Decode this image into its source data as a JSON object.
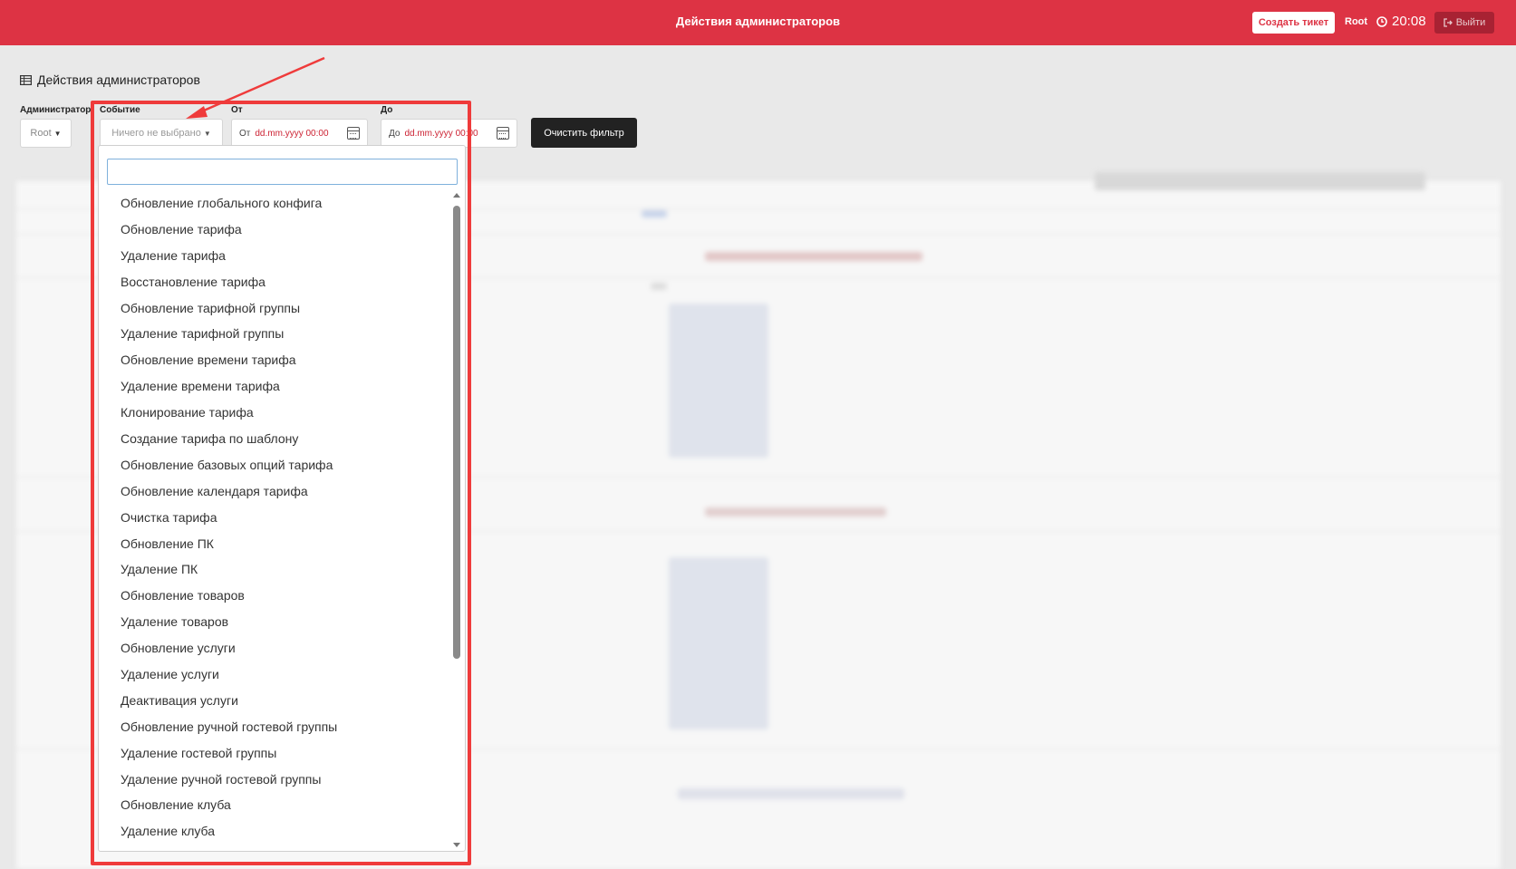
{
  "header": {
    "title": "Действия администраторов",
    "create_ticket": "Создать тикет",
    "user": "Root",
    "time": "20:08",
    "logout": "Выйти"
  },
  "page": {
    "title": "Действия администраторов"
  },
  "filters": {
    "admin_label": "Администратор",
    "admin_value": "Root",
    "event_label": "Событие",
    "event_value": "Ничего не выбрано",
    "from_label": "От",
    "from_prefix": "От",
    "from_placeholder": "dd.mm.yyyy 00:00",
    "to_label": "До",
    "to_prefix": "До",
    "to_placeholder": "dd.mm.yyyy 00:00",
    "clear_button": "Очистить фильтр"
  },
  "dropdown": {
    "search_value": "",
    "options": [
      "Обновление глобального конфига",
      "Обновление тарифа",
      "Удаление тарифа",
      "Восстановление тарифа",
      "Обновление тарифной группы",
      "Удаление тарифной группы",
      "Обновление времени тарифа",
      "Удаление времени тарифа",
      "Клонирование тарифа",
      "Создание тарифа по шаблону",
      "Обновление базовых опций тарифа",
      "Обновление календаря тарифа",
      "Очистка тарифа",
      "Обновление ПК",
      "Удаление ПК",
      "Обновление товаров",
      "Удаление товаров",
      "Обновление услуги",
      "Удаление услуги",
      "Деактивация услуги",
      "Обновление ручной гостевой группы",
      "Удаление гостевой группы",
      "Удаление ручной гостевой группы",
      "Обновление клуба",
      "Удаление клуба"
    ]
  },
  "annotation": {
    "color": "#ef3b3b"
  }
}
